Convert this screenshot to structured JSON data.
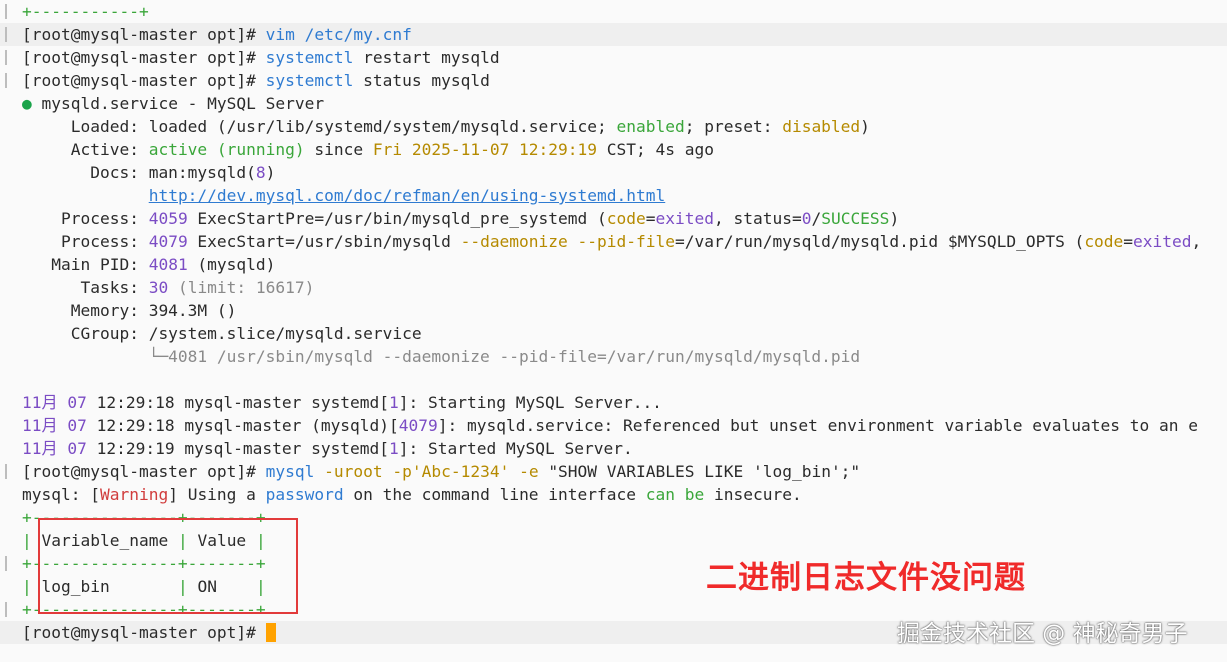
{
  "terminal": {
    "lines": [
      {
        "gutter": true,
        "highlight": false,
        "segs": [
          {
            "t": "+-----------+",
            "c": "green"
          }
        ]
      },
      {
        "gutter": true,
        "highlight": true,
        "segs": [
          {
            "t": "[root@mysql-master opt]# "
          },
          {
            "t": "vim",
            "c": "blue"
          },
          {
            "t": " /etc/my.cnf",
            "c": "blue"
          }
        ]
      },
      {
        "gutter": true,
        "highlight": false,
        "segs": [
          {
            "t": "[root@mysql-master opt]# "
          },
          {
            "t": "systemctl",
            "c": "blue"
          },
          {
            "t": " restart mysqld"
          }
        ]
      },
      {
        "gutter": true,
        "highlight": false,
        "segs": [
          {
            "t": "[root@mysql-master opt]# "
          },
          {
            "t": "systemctl",
            "c": "blue"
          },
          {
            "t": " status mysqld"
          }
        ]
      },
      {
        "gutter": false,
        "highlight": false,
        "segs": [
          {
            "t": "●",
            "c": "dot"
          },
          {
            "t": " mysqld.service - MySQL Server"
          }
        ]
      },
      {
        "gutter": false,
        "highlight": false,
        "segs": [
          {
            "t": "     Loaded: loaded ("
          },
          {
            "t": "/usr/lib/systemd/system/mysqld.service; "
          },
          {
            "t": "enabled",
            "c": "green"
          },
          {
            "t": "; preset: "
          },
          {
            "t": "disabled",
            "c": "yellow"
          },
          {
            "t": ")"
          }
        ]
      },
      {
        "gutter": false,
        "highlight": false,
        "segs": [
          {
            "t": "     Active: "
          },
          {
            "t": "active (running)",
            "c": "green"
          },
          {
            "t": " since "
          },
          {
            "t": "Fri 2025-11-07 12:29:19",
            "c": "yellow"
          },
          {
            "t": " CST; 4s ago"
          }
        ]
      },
      {
        "gutter": false,
        "highlight": false,
        "segs": [
          {
            "t": "       Docs: man:mysqld("
          },
          {
            "t": "8",
            "c": "purple"
          },
          {
            "t": ")"
          }
        ]
      },
      {
        "gutter": false,
        "highlight": false,
        "segs": [
          {
            "t": "             "
          },
          {
            "t": "http://dev.mysql.com/doc/refman/en/using-systemd.html",
            "c": "link"
          }
        ]
      },
      {
        "gutter": false,
        "highlight": false,
        "segs": [
          {
            "t": "    Process: "
          },
          {
            "t": "4059",
            "c": "purple"
          },
          {
            "t": " ExecStartPre=/usr/bin/mysqld_pre_systemd ("
          },
          {
            "t": "code",
            "c": "yellow"
          },
          {
            "t": "="
          },
          {
            "t": "exited",
            "c": "purple"
          },
          {
            "t": ", status="
          },
          {
            "t": "0",
            "c": "purple"
          },
          {
            "t": "/"
          },
          {
            "t": "SUCCESS",
            "c": "green"
          },
          {
            "t": ")"
          }
        ]
      },
      {
        "gutter": false,
        "highlight": false,
        "segs": [
          {
            "t": "    Process: "
          },
          {
            "t": "4079",
            "c": "purple"
          },
          {
            "t": " ExecStart=/usr/sbin/mysqld "
          },
          {
            "t": "--daemonize --pid-file",
            "c": "yellow"
          },
          {
            "t": "=/var/run/mysqld/mysqld.pid $MYSQLD_OPTS ("
          },
          {
            "t": "code",
            "c": "yellow"
          },
          {
            "t": "="
          },
          {
            "t": "exited",
            "c": "purple"
          },
          {
            "t": ","
          }
        ]
      },
      {
        "gutter": false,
        "highlight": false,
        "segs": [
          {
            "t": "   Main PID: "
          },
          {
            "t": "4081",
            "c": "purple"
          },
          {
            "t": " (mysqld)"
          }
        ]
      },
      {
        "gutter": false,
        "highlight": false,
        "segs": [
          {
            "t": "      Tasks: "
          },
          {
            "t": "30",
            "c": "purple"
          },
          {
            "t": " (limit: 16617)",
            "c": "gray"
          }
        ]
      },
      {
        "gutter": false,
        "highlight": false,
        "segs": [
          {
            "t": "     Memory: 394.3M ()"
          }
        ]
      },
      {
        "gutter": false,
        "highlight": false,
        "segs": [
          {
            "t": "     CGroup: /system.slice/mysqld.service"
          }
        ]
      },
      {
        "gutter": false,
        "highlight": false,
        "segs": [
          {
            "t": "             └─4081 /usr/sbin/mysqld --daemonize --pid-file=/var/run/mysqld/mysqld.pid",
            "c": "gray"
          }
        ]
      },
      {
        "gutter": false,
        "highlight": false,
        "segs": [
          {
            "t": ""
          }
        ]
      },
      {
        "gutter": false,
        "highlight": false,
        "segs": [
          {
            "t": "11月 07",
            "c": "purple"
          },
          {
            "t": " 12:29:18 mysql-master systemd["
          },
          {
            "t": "1",
            "c": "purple"
          },
          {
            "t": "]: Starting MySQL Server..."
          }
        ]
      },
      {
        "gutter": false,
        "highlight": false,
        "segs": [
          {
            "t": "11月 07",
            "c": "purple"
          },
          {
            "t": " 12:29:18 mysql-master (mysqld)["
          },
          {
            "t": "4079",
            "c": "purple"
          },
          {
            "t": "]: mysqld.service: Referenced but unset environment variable evaluates to an e"
          }
        ]
      },
      {
        "gutter": false,
        "highlight": false,
        "segs": [
          {
            "t": "11月 07",
            "c": "purple"
          },
          {
            "t": " 12:29:19 mysql-master systemd["
          },
          {
            "t": "1",
            "c": "purple"
          },
          {
            "t": "]: Started MySQL Server."
          }
        ]
      },
      {
        "gutter": true,
        "highlight": false,
        "segs": [
          {
            "t": "[root@mysql-master opt]# "
          },
          {
            "t": "mysql",
            "c": "blue"
          },
          {
            "t": " -uroot -p",
            "c": "yellow"
          },
          {
            "t": "'Abc-1234'",
            "c": "yellow"
          },
          {
            "t": " -e ",
            "c": "yellow"
          },
          {
            "t": "\"SHOW VARIABLES LIKE 'log_bin';\""
          }
        ]
      },
      {
        "gutter": false,
        "highlight": false,
        "segs": [
          {
            "t": "mysql: ["
          },
          {
            "t": "Warning",
            "c": "red"
          },
          {
            "t": "] Using a "
          },
          {
            "t": "password",
            "c": "blue"
          },
          {
            "t": " on the command line interface "
          },
          {
            "t": "can be",
            "c": "green"
          },
          {
            "t": " insecure."
          }
        ]
      },
      {
        "gutter": false,
        "highlight": false,
        "segs": [
          {
            "t": "+---------------+-------+",
            "c": "green"
          }
        ]
      },
      {
        "gutter": false,
        "highlight": false,
        "segs": [
          {
            "t": "| ",
            "c": "green"
          },
          {
            "t": "Variable_name "
          },
          {
            "t": "| ",
            "c": "green"
          },
          {
            "t": "Value "
          },
          {
            "t": "|",
            "c": "green"
          }
        ]
      },
      {
        "gutter": true,
        "highlight": false,
        "segs": [
          {
            "t": "+---------------+-------+",
            "c": "green"
          }
        ]
      },
      {
        "gutter": false,
        "highlight": false,
        "segs": [
          {
            "t": "| ",
            "c": "green"
          },
          {
            "t": "log_bin       "
          },
          {
            "t": "| ",
            "c": "green"
          },
          {
            "t": "ON    "
          },
          {
            "t": "|",
            "c": "green"
          }
        ]
      },
      {
        "gutter": true,
        "highlight": false,
        "segs": [
          {
            "t": "+---------------+-------+",
            "c": "green"
          }
        ]
      },
      {
        "gutter": false,
        "highlight": true,
        "segs": [
          {
            "t": "[root@mysql-master opt]# "
          }
        ],
        "cursor": true
      }
    ]
  },
  "annotation": "二进制日志文件没问题",
  "watermark": "掘金技术社区 @ 神秘奇男子"
}
